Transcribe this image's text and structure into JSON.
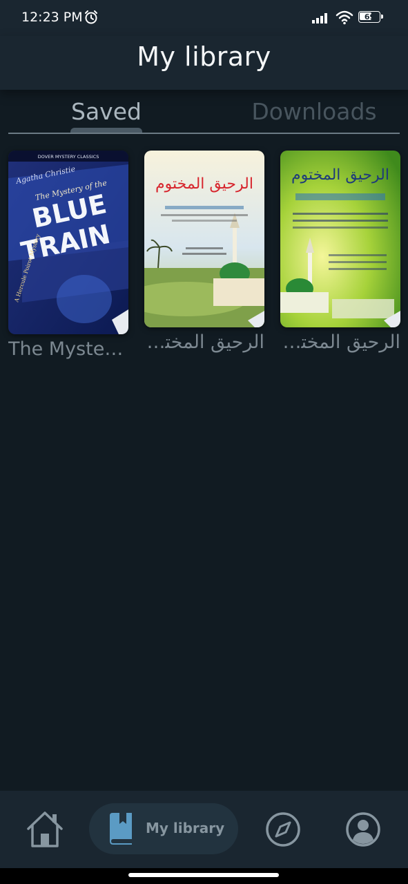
{
  "status_bar": {
    "time": "12:23 PM",
    "battery": "69",
    "icons": [
      "alarm-icon",
      "signal-icon",
      "wifi-icon",
      "battery-icon"
    ]
  },
  "header": {
    "title": "My library"
  },
  "tabs": [
    {
      "label": "Saved",
      "active": true
    },
    {
      "label": "Downloads",
      "active": false
    }
  ],
  "books": [
    {
      "title": "The Mystery of the Blue Train",
      "cover": {
        "series": "DOVER MYSTERY CLASSICS",
        "author": "Agatha Christie",
        "line1": "The Mystery of the",
        "line2": "BLUE",
        "line3": "TRAIN",
        "tag": "A Hercule Poirot Mystery"
      }
    },
    {
      "title": "الرحيق المختوم",
      "cover": {
        "heading": "الرحيق المختوم"
      }
    },
    {
      "title": "الرحيق المختوم",
      "cover": {
        "heading": "الرحيق المختوم"
      }
    }
  ],
  "bottom_nav": {
    "items": [
      {
        "icon": "home-icon",
        "active": false
      },
      {
        "icon": "book-icon",
        "label": "My library",
        "active": true
      },
      {
        "icon": "compass-icon",
        "active": false
      },
      {
        "icon": "profile-icon",
        "active": false
      }
    ]
  },
  "colors": {
    "background": "#111b22",
    "bar": "#1a2630",
    "active_pill": "#22333f",
    "accent_icon": "#5b9bc4"
  }
}
